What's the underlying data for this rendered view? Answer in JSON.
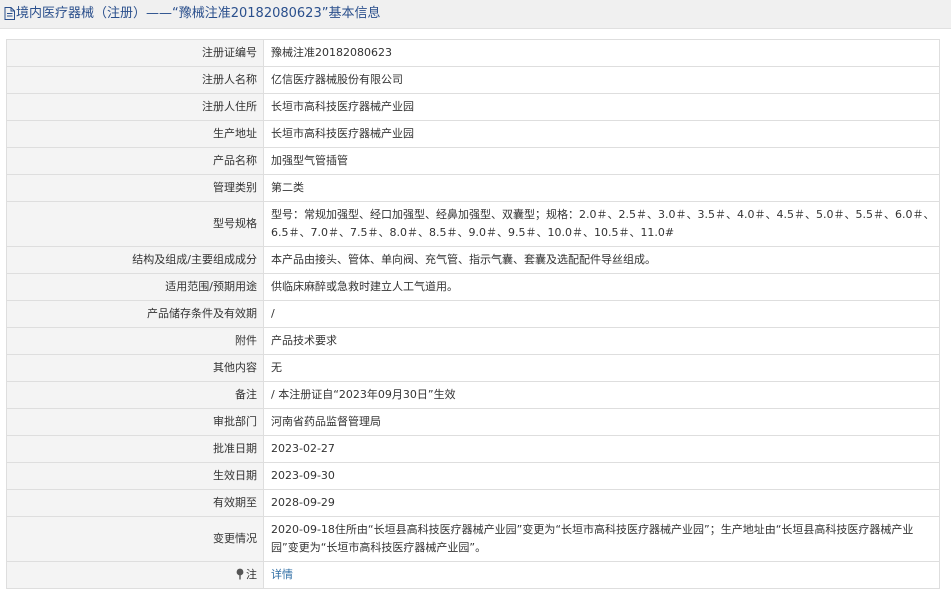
{
  "header": {
    "title": "境内医疗器械（注册）——“豫械注准20182080623”基本信息"
  },
  "rows": [
    {
      "label": "注册证编号",
      "value": "豫械注准20182080623"
    },
    {
      "label": "注册人名称",
      "value": "亿信医疗器械股份有限公司"
    },
    {
      "label": "注册人住所",
      "value": "长垣市高科技医疗器械产业园"
    },
    {
      "label": "生产地址",
      "value": "长垣市高科技医疗器械产业园"
    },
    {
      "label": "产品名称",
      "value": "加强型气管插管"
    },
    {
      "label": "管理类别",
      "value": "第二类"
    },
    {
      "label": "型号规格",
      "value": "型号：常规加强型、经口加强型、经鼻加强型、双囊型；规格：2.0＃、2.5＃、3.0＃、3.5＃、4.0＃、4.5＃、5.0＃、5.5＃、6.0＃、6.5＃、7.0＃、7.5＃、8.0＃、8.5＃、9.0＃、9.5＃、10.0＃、10.5＃、11.0#"
    },
    {
      "label": "结构及组成/主要组成成分",
      "value": "本产品由接头、管体、单向阀、充气管、指示气囊、套囊及选配配件导丝组成。"
    },
    {
      "label": "适用范围/预期用途",
      "value": "供临床麻醉或急救时建立人工气道用。"
    },
    {
      "label": "产品储存条件及有效期",
      "value": "/"
    },
    {
      "label": "附件",
      "value": "产品技术要求"
    },
    {
      "label": "其他内容",
      "value": "无"
    },
    {
      "label": "备注",
      "value": "/ 本注册证自“2023年09月30日”生效"
    },
    {
      "label": "审批部门",
      "value": "河南省药品监督管理局"
    },
    {
      "label": "批准日期",
      "value": "2023-02-27"
    },
    {
      "label": "生效日期",
      "value": "2023-09-30"
    },
    {
      "label": "有效期至",
      "value": "2028-09-29"
    },
    {
      "label": "变更情况",
      "value": "2020-09-18住所由“长垣县高科技医疗器械产业园”变更为“长垣市高科技医疗器械产业园”；生产地址由“长垣县高科技医疗器械产业园”变更为“长垣市高科技医疗器械产业园”。"
    }
  ],
  "note": {
    "label": "注",
    "link_text": "详情",
    "icon": "pin-icon"
  },
  "colors": {
    "header_text": "#2a4f8c",
    "label_bg": "#f4f4f4",
    "border": "#dedede",
    "link": "#2e6da4"
  }
}
